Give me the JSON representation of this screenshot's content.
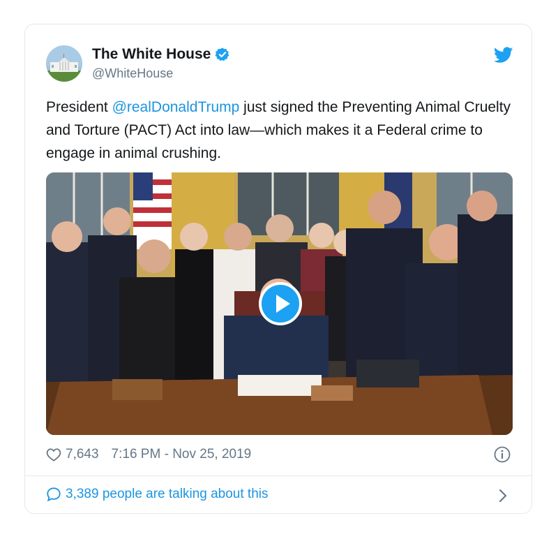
{
  "tweet": {
    "display_name": "The White House",
    "handle": "@WhiteHouse",
    "text_before": "President ",
    "mention": "@realDonaldTrump",
    "text_after": " just signed the Preventing Animal Cruelty and Torture (PACT) Act into law—which makes it a Federal crime to engage in animal crushing.",
    "likes": "7,643",
    "timestamp": "7:16 PM - Nov 25, 2019",
    "talking": "3,389 people are talking about this"
  },
  "icons": {
    "verified": "verified-badge-icon",
    "twitter": "twitter-bird-icon",
    "play": "play-icon",
    "like": "heart-icon",
    "info": "info-icon",
    "comment": "comment-bubble-icon",
    "chevron": "chevron-right-icon"
  },
  "colors": {
    "twitter_blue": "#1da1f2",
    "link_blue": "#1b95e0",
    "secondary_text": "#657786",
    "border": "#e1e8ed"
  }
}
